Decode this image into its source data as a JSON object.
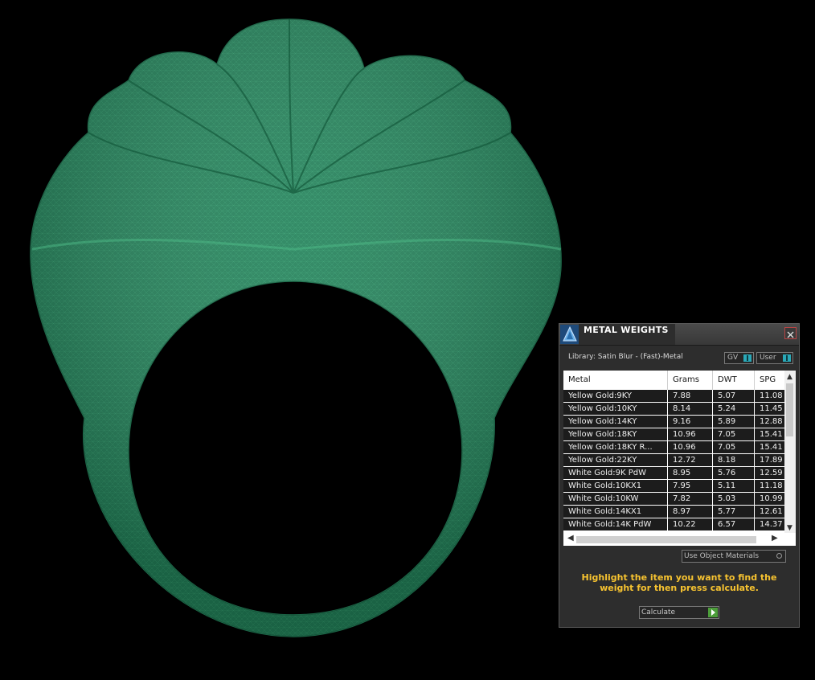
{
  "panel": {
    "title": "METAL WEIGHTS",
    "library_label": "Library: Satin Blur - (Fast)-Metal",
    "toggles": {
      "gv": "GV",
      "user": "User"
    },
    "columns": [
      "Metal",
      "Grams",
      "DWT",
      "SPG"
    ],
    "rows": [
      [
        "Yellow Gold:9KY",
        "7.88",
        "5.07",
        "11.08"
      ],
      [
        "Yellow Gold:10KY",
        "8.14",
        "5.24",
        "11.45"
      ],
      [
        "Yellow Gold:14KY",
        "9.16",
        "5.89",
        "12.88"
      ],
      [
        "Yellow Gold:18KY",
        "10.96",
        "7.05",
        "15.41"
      ],
      [
        "Yellow Gold:18KY R...",
        "10.96",
        "7.05",
        "15.41"
      ],
      [
        "Yellow Gold:22KY",
        "12.72",
        "8.18",
        "17.89"
      ],
      [
        "White Gold:9K PdW",
        "8.95",
        "5.76",
        "12.59"
      ],
      [
        "White Gold:10KX1",
        "7.95",
        "5.11",
        "11.18"
      ],
      [
        "White Gold:10KW",
        "7.82",
        "5.03",
        "10.99"
      ],
      [
        "White Gold:14KX1",
        "8.97",
        "5.77",
        "12.61"
      ],
      [
        "White Gold:14K PdW",
        "10.22",
        "6.57",
        "14.37"
      ]
    ],
    "use_object_materials": "Use Object Materials",
    "help_text": "Highlight the item you want to find the weight for then press calculate.",
    "calculate_label": "Calculate"
  },
  "colors": {
    "model": "#23825a",
    "accent": "#f7c330",
    "toggle_on": "#2aa9b8",
    "calc_arrow": "#4c9e3a"
  }
}
